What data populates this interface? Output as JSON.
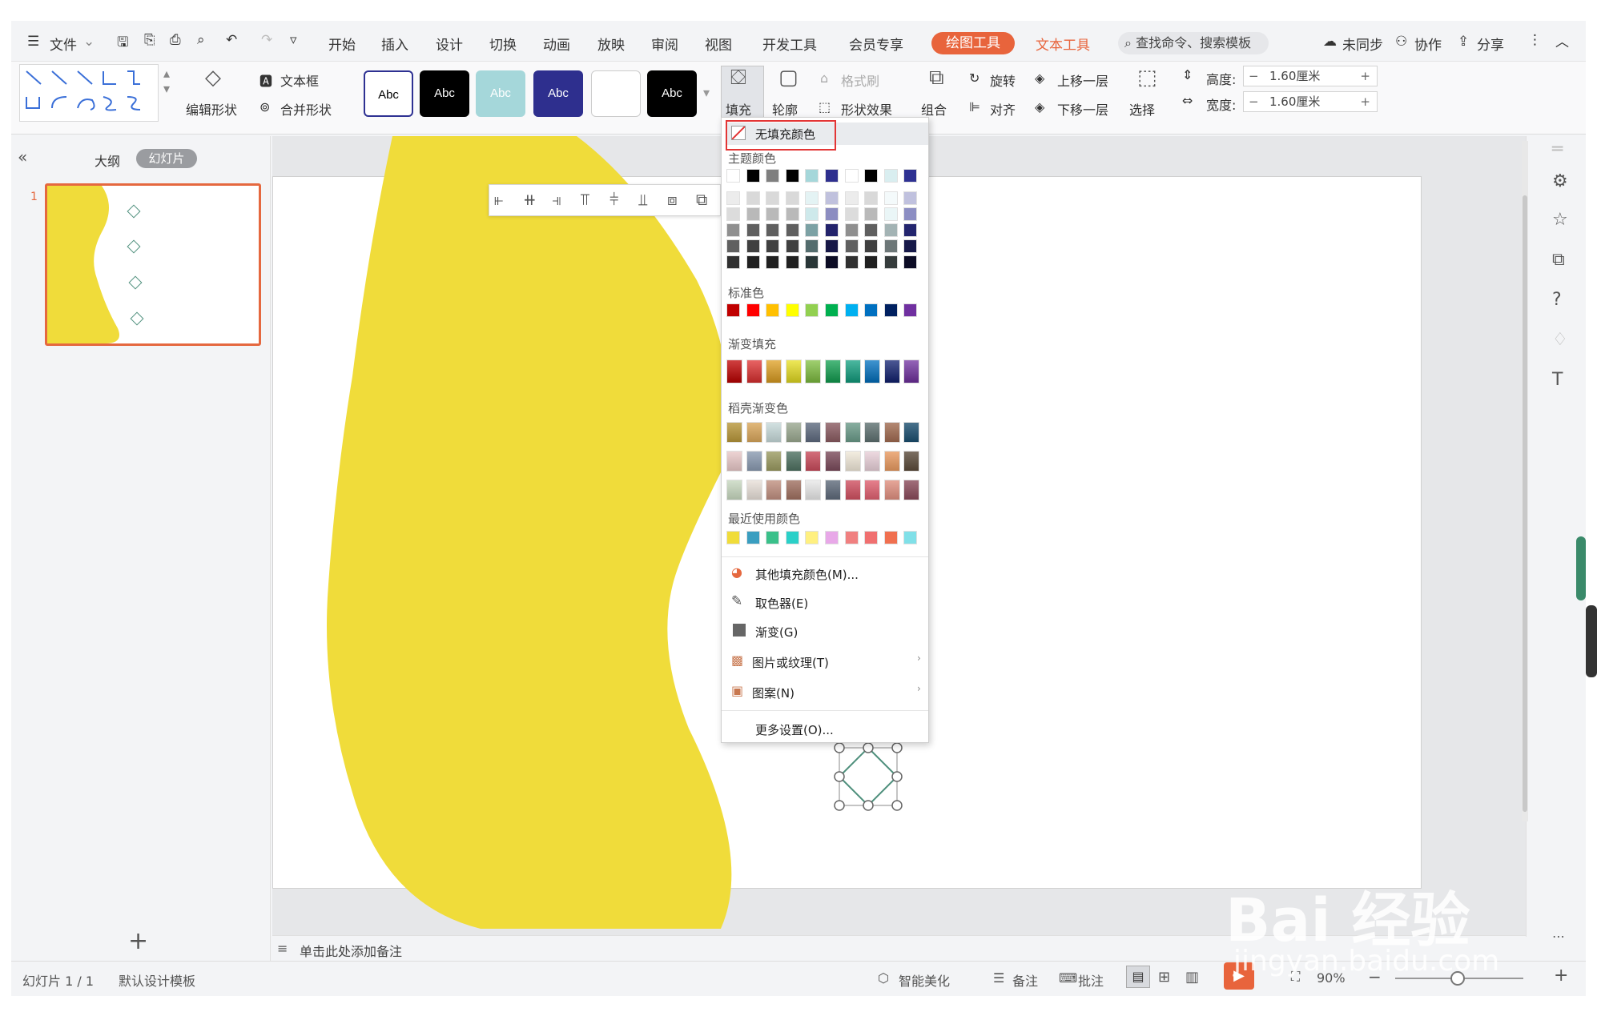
{
  "menu": {
    "file": "文件",
    "tabs": [
      "开始",
      "插入",
      "设计",
      "切换",
      "动画",
      "放映",
      "审阅",
      "视图",
      "开发工具",
      "会员专享"
    ],
    "active_tab": "绘图工具",
    "text_tool_tab": "文本工具",
    "search": "查找命令、搜索模板",
    "sync": "未同步",
    "collab": "协作",
    "share": "分享"
  },
  "ribbon": {
    "edit_shape": "编辑形状",
    "textbox": "文本框",
    "merge_shape": "合并形状",
    "style_samples": [
      "Abc",
      "Abc",
      "Abc",
      "Abc",
      "",
      "Abc"
    ],
    "fill": "填充",
    "outline": "轮廓",
    "format_painter": "格式刷",
    "shape_effect": "形状效果",
    "group": "组合",
    "rotate": "旋转",
    "align": "对齐",
    "bring_forward": "上移一层",
    "send_backward": "下移一层",
    "select": "选择",
    "height_label": "高度:",
    "height_value": "1.60厘米",
    "width_label": "宽度:",
    "width_value": "1.60厘米"
  },
  "leftpanel": {
    "outline_tab": "大纲",
    "slides_tab": "幻灯片",
    "slide_number": "1"
  },
  "fill_menu": {
    "no_fill": "无填充颜色",
    "theme_colors": "主题颜色",
    "standard_colors": "标准色",
    "gradient_fill": "渐变填充",
    "daoke_gradient": "稻壳渐变色",
    "recent_colors": "最近使用颜色",
    "more_fill": "其他填充颜色(M)...",
    "eyedropper": "取色器(E)",
    "gradient": "渐变(G)",
    "picture_texture": "图片或纹理(T)",
    "pattern": "图案(N)",
    "more_settings": "更多设置(O)...",
    "theme_top": [
      "#ffffff",
      "#000000",
      "#7f7f7f",
      "#000000",
      "#a5d7da",
      "#2e2f8e",
      "#ffffff",
      "#000000",
      "#d9eef0",
      "#2e3192"
    ],
    "standard": [
      "#c00000",
      "#ff0000",
      "#ffc000",
      "#ffff00",
      "#92d050",
      "#00b050",
      "#00b0f0",
      "#0070c0",
      "#002060",
      "#7030a0"
    ],
    "gradients": [
      "#c00000",
      "#e03030",
      "#e0a020",
      "#e8e020",
      "#80c040",
      "#10a050",
      "#10a080",
      "#0070c0",
      "#102070",
      "#7030a0"
    ],
    "daoke_row1": [
      "#b8963a",
      "#d9a65a",
      "#c7dada",
      "#9aa890",
      "#5e6a7e",
      "#8a5a60",
      "#6a9a88",
      "#5e7070",
      "#a06a50",
      "#1a4e6e"
    ],
    "daoke_row2": [
      "#e8c8c8",
      "#8a9ab0",
      "#9a9a60",
      "#4e7060",
      "#c84a5a",
      "#7a4a5a",
      "#f0e8d8",
      "#e8d0d8",
      "#e89a60",
      "#5a4a3a"
    ],
    "daoke_row3": [
      "#c8d8c0",
      "#e8e0d8",
      "#c09080",
      "#a07060",
      "#e8e8e8",
      "#5e6a7a",
      "#d05060",
      "#e06070",
      "#e09080",
      "#8a4a5a"
    ],
    "recent": [
      "#f0dc3a",
      "#3a9ec0",
      "#3ac08a",
      "#2ad0c8",
      "#fff080",
      "#e8a8e8",
      "#f08080",
      "#f07070",
      "#f07050",
      "#80e0e8"
    ]
  },
  "notes_hint": "单击此处添加备注",
  "status": {
    "slide_info": "幻灯片 1 / 1",
    "template": "默认设计模板",
    "smart": "智能美化",
    "notes": "备注",
    "comments": "批注",
    "zoom": "90%"
  },
  "watermark": {
    "brand": "Bai  经验",
    "url": "jingyan.baidu.com"
  },
  "colors": {
    "accent": "#e8643c",
    "shape_yellow": "#f0dc3a",
    "highlight_red": "#e33535"
  }
}
